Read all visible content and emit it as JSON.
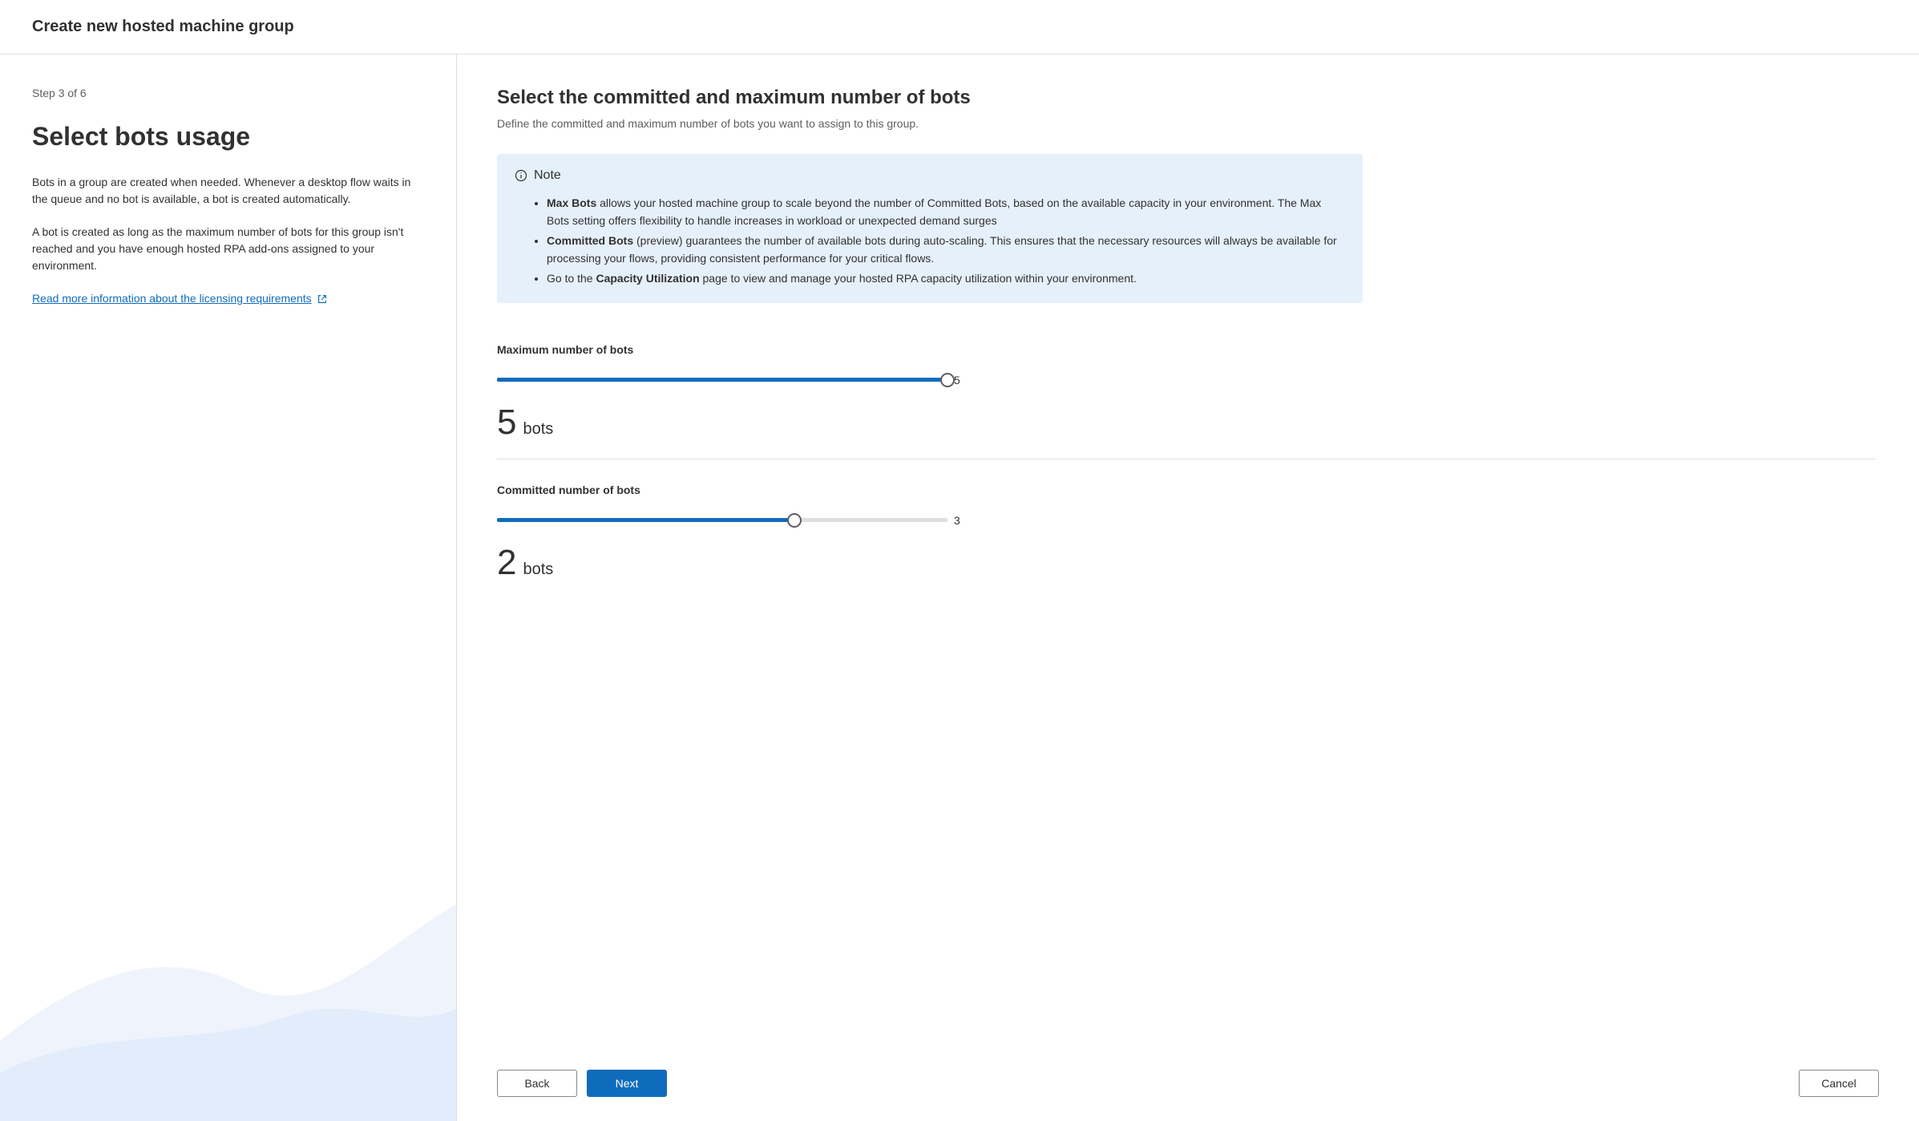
{
  "header": {
    "title": "Create new hosted machine group"
  },
  "sidebar": {
    "step": "Step 3 of 6",
    "heading": "Select bots usage",
    "paragraph1": "Bots in a group are created when needed. Whenever a desktop flow waits in the queue and no bot is available, a bot is created automatically.",
    "paragraph2": "A bot is created as long as the maximum number of bots for this group isn't reached and you have enough hosted RPA add-ons assigned to your environment.",
    "link_text": "Read more information about the licensing requirements"
  },
  "main": {
    "title": "Select the committed and maximum number of bots",
    "subtitle": "Define the committed and maximum number of bots you want to assign to this group."
  },
  "note": {
    "label": "Note",
    "item1_bold": "Max Bots",
    "item1_text": " allows your hosted machine group to scale beyond the number of Committed Bots, based on the available capacity in your environment. The Max Bots setting offers flexibility to handle increases in workload or unexpected demand surges",
    "item2_bold": "Committed Bots",
    "item2_text": " (preview) guarantees the number of available bots during auto-scaling. This ensures that the necessary resources will always be available for processing your flows, providing consistent performance for your critical flows.",
    "item3_prefix": "Go to the ",
    "item3_bold": "Capacity Utilization",
    "item3_text": " page to view and manage your hosted RPA capacity utilization within your environment."
  },
  "sliders": {
    "max": {
      "label": "Maximum number of bots",
      "value": "5",
      "max_display": "5",
      "suffix": "bots",
      "fill_percent": 100,
      "thumb_percent": 100
    },
    "committed": {
      "label": "Committed number of bots",
      "value": "2",
      "max_display": "3",
      "suffix": "bots",
      "fill_percent": 66,
      "thumb_percent": 66
    }
  },
  "footer": {
    "back": "Back",
    "next": "Next",
    "cancel": "Cancel"
  }
}
